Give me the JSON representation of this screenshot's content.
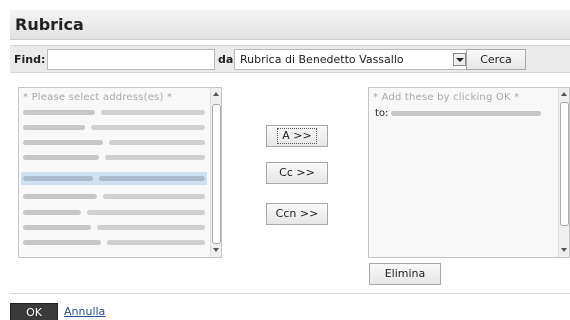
{
  "dialog": {
    "title": "Rubrica"
  },
  "search": {
    "find_label": "Find:",
    "find_value": "",
    "da_label": "da",
    "address_book": "Rubrica di Benedetto Vassallo",
    "search_button": "Cerca"
  },
  "available": {
    "placeholder": "* Please select address(es) *",
    "entries": [
      {
        "selected": false
      },
      {
        "selected": false
      },
      {
        "selected": false
      },
      {
        "selected": false
      },
      {
        "selected": true
      },
      {
        "selected": false
      },
      {
        "selected": false
      },
      {
        "selected": false
      },
      {
        "selected": false
      }
    ]
  },
  "actions": {
    "to_button": "A >>",
    "cc_button": "Cc >>",
    "bcc_button": "Ccn >>"
  },
  "recipients": {
    "placeholder": "* Add these by clicking OK *",
    "to_prefix": "to:",
    "remove_button": "Elimina"
  },
  "footer": {
    "ok_button": "OK",
    "cancel_link": "Annulla"
  }
}
